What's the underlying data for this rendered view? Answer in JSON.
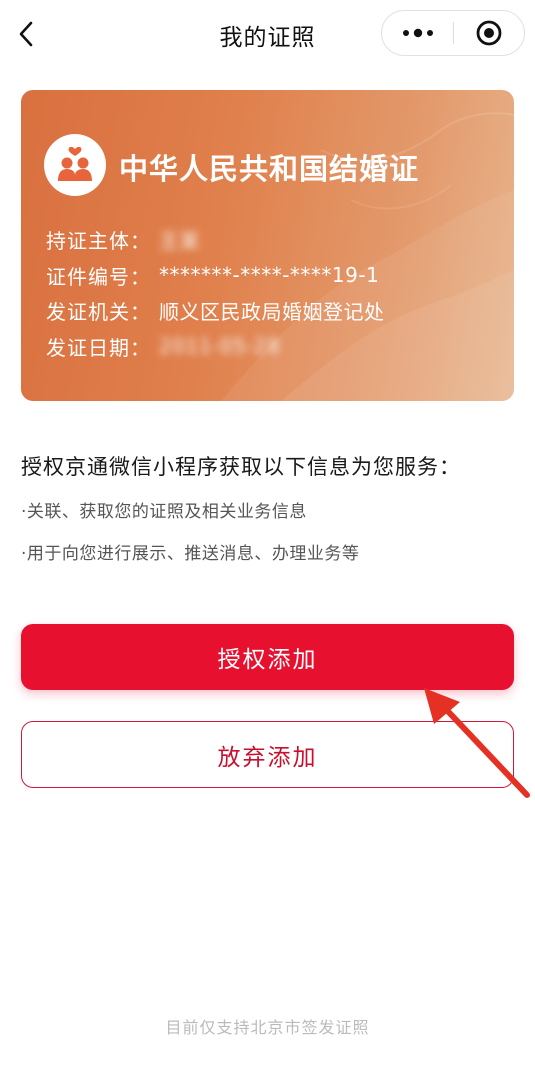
{
  "navbar": {
    "back_icon": "chevron-left-icon",
    "title": "我的证照",
    "more_icon": "more-dots-icon",
    "close_icon": "target-circle-icon"
  },
  "card": {
    "title": "中华人民共和国结婚证",
    "avatar_icon": "couple-heart-icon",
    "rows": [
      {
        "label": "持证主体：",
        "value": "王某",
        "blurred": true
      },
      {
        "label": "证件编号：",
        "value": "*******-****-****19-1",
        "blurred": false
      },
      {
        "label": "发证机关：",
        "value": "顺义区民政局婚姻登记处",
        "blurred": false
      },
      {
        "label": "发证日期：",
        "value": "2011-05-28",
        "blurred": true
      }
    ],
    "colors": {
      "gradient_start": "#d9703f",
      "gradient_end": "#e8b58e"
    }
  },
  "auth": {
    "title": "授权京通微信小程序获取以下信息为您服务：",
    "items": [
      "·关联、获取您的证照及相关业务信息",
      "·用于向您进行展示、推送消息、办理业务等"
    ]
  },
  "buttons": {
    "authorize_label": "授权添加",
    "decline_label": "放弃添加",
    "primary_color": "#e8102f"
  },
  "annotation": {
    "arrow_icon": "red-arrow-pointer-icon",
    "color": "#e53024"
  },
  "footer": {
    "note": "目前仅支持北京市签发证照"
  }
}
